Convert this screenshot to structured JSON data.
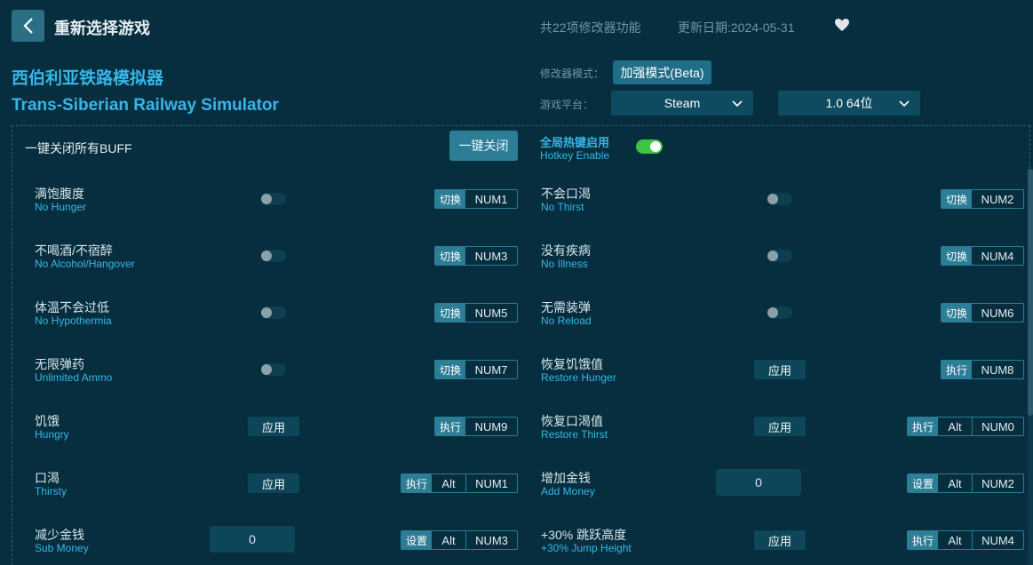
{
  "header": {
    "back_icon": "chevron-left-icon",
    "title": "重新选择游戏",
    "feature_count": "共22项修改器功能",
    "update_date": "更新日期:2024-05-31",
    "favorite_icon": "heart-icon"
  },
  "game": {
    "name_cn": "西伯利亚铁路模拟器",
    "name_en": "Trans-Siberian Railway Simulator"
  },
  "settings": {
    "mode_label": "修改器模式：",
    "mode_value": "加强模式(Beta)",
    "platform_label": "游戏平台：",
    "platform_value": "Steam",
    "version_value": "1.0 64位"
  },
  "controls": {
    "all_buff_label": "一键关闭所有BUFF",
    "close_all_button": "一键关闭",
    "hotkey_cn": "全局热键启用",
    "hotkey_en": "Hotkey Enable",
    "hotkey_enabled": true
  },
  "options": {
    "left": [
      {
        "cn": "满饱腹度",
        "en": "No Hunger",
        "control": "toggle",
        "on": false,
        "action": "切换",
        "keys": [
          "NUM1"
        ]
      },
      {
        "cn": "不喝酒/不宿醉",
        "en": "No Alcohol/Hangover",
        "control": "toggle",
        "on": false,
        "action": "切换",
        "keys": [
          "NUM3"
        ]
      },
      {
        "cn": "体温不会过低",
        "en": "No Hypothermia",
        "control": "toggle",
        "on": false,
        "action": "切换",
        "keys": [
          "NUM5"
        ]
      },
      {
        "cn": "无限弹药",
        "en": "Unlimited Ammo",
        "control": "toggle",
        "on": false,
        "action": "切换",
        "keys": [
          "NUM7"
        ]
      },
      {
        "cn": "饥饿",
        "en": "Hungry",
        "control": "apply",
        "control_label": "应用",
        "action": "执行",
        "keys": [
          "NUM9"
        ]
      },
      {
        "cn": "口渴",
        "en": "Thirsty",
        "control": "apply",
        "control_label": "应用",
        "action": "执行",
        "keys": [
          "Alt",
          "NUM1"
        ]
      },
      {
        "cn": "减少金钱",
        "en": "Sub Money",
        "control": "input",
        "value": "0",
        "action": "设置",
        "keys": [
          "Alt",
          "NUM3"
        ]
      }
    ],
    "right": [
      {
        "cn": "不会口渴",
        "en": "No Thirst",
        "control": "toggle",
        "on": false,
        "action": "切换",
        "keys": [
          "NUM2"
        ]
      },
      {
        "cn": "没有疾病",
        "en": "No Illness",
        "control": "toggle",
        "on": false,
        "action": "切换",
        "keys": [
          "NUM4"
        ]
      },
      {
        "cn": "无需装弹",
        "en": "No Reload",
        "control": "toggle",
        "on": false,
        "action": "切换",
        "keys": [
          "NUM6"
        ]
      },
      {
        "cn": "恢复饥饿值",
        "en": "Restore Hunger",
        "control": "apply",
        "control_label": "应用",
        "action": "执行",
        "keys": [
          "NUM8"
        ]
      },
      {
        "cn": "恢复口渴值",
        "en": "Restore Thirst",
        "control": "apply",
        "control_label": "应用",
        "action": "执行",
        "keys": [
          "Alt",
          "NUM0"
        ]
      },
      {
        "cn": "增加金钱",
        "en": "Add Money",
        "control": "input",
        "value": "0",
        "action": "设置",
        "keys": [
          "Alt",
          "NUM2"
        ]
      },
      {
        "cn": "+30% 跳跃高度",
        "en": "+30% Jump Height",
        "control": "apply",
        "control_label": "应用",
        "action": "执行",
        "keys": [
          "Alt",
          "NUM4"
        ]
      }
    ]
  },
  "colors": {
    "background": "#062e3e",
    "accent": "#37b6e8",
    "button": "#2c7d96",
    "toggle_on": "#3fc546"
  }
}
